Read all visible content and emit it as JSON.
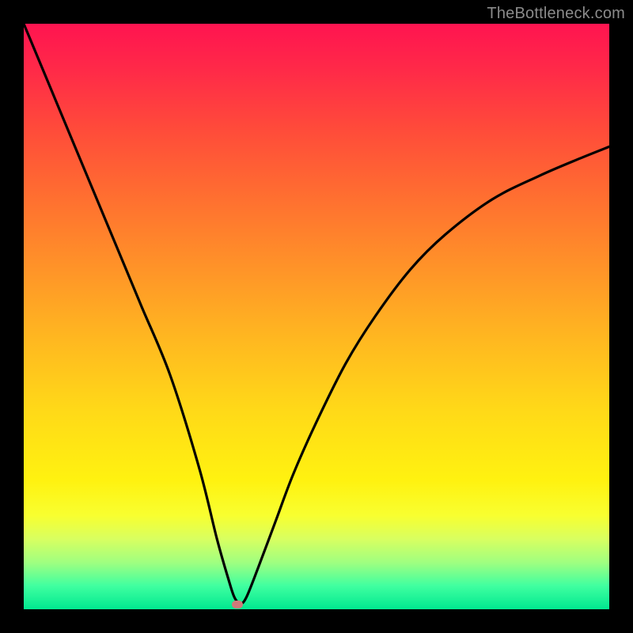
{
  "watermark": "TheBottleneck.com",
  "chart_data": {
    "type": "line",
    "title": "",
    "xlabel": "",
    "ylabel": "",
    "xlim": [
      0,
      100
    ],
    "ylim": [
      0,
      100
    ],
    "grid": false,
    "legend": false,
    "series": [
      {
        "name": "bottleneck-curve",
        "x": [
          0,
          5,
          10,
          15,
          20,
          25,
          30,
          33,
          35,
          36,
          37,
          38,
          40,
          43,
          46,
          50,
          55,
          60,
          66,
          72,
          80,
          88,
          95,
          100
        ],
        "y": [
          100,
          88,
          76,
          64,
          52,
          40,
          24,
          12,
          5,
          2,
          1,
          2,
          7,
          15,
          23,
          32,
          42,
          50,
          58,
          64,
          70,
          74,
          77,
          79
        ]
      }
    ],
    "marker": {
      "x": 36.5,
      "y": 0.8,
      "color": "#cf7a7a"
    },
    "background_gradient": {
      "stops": [
        {
          "pos": 0.0,
          "color": "#ff1450"
        },
        {
          "pos": 0.3,
          "color": "#ff7030"
        },
        {
          "pos": 0.66,
          "color": "#ffd918"
        },
        {
          "pos": 0.88,
          "color": "#d8ff60"
        },
        {
          "pos": 1.0,
          "color": "#00e890"
        }
      ]
    }
  }
}
